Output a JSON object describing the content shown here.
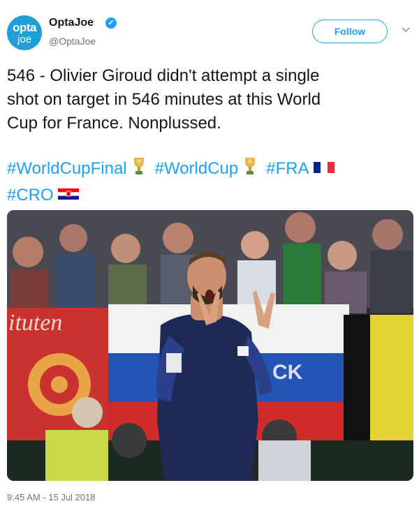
{
  "account": {
    "avatar_line1": "opta",
    "avatar_line2": "joe",
    "display_name": "OptaJoe",
    "handle": "@OptaJoe",
    "verified_icon": "verified-badge-icon"
  },
  "follow_label": "Follow",
  "tweet": {
    "text": "546 - Olivier Giroud didn't attempt a single\nshot on target in 546 minutes at this World\nCup for France. Nonplussed."
  },
  "hashtags": {
    "worldcupfinal": "#WorldCupFinal",
    "worldcup": "#WorldCup",
    "fra": "#FRA",
    "cro": "#CRO"
  },
  "media": {
    "banner_text": "ituten",
    "flag_text": "CK"
  },
  "timestamp": "9:45 AM - 15 Jul 2018",
  "colors": {
    "link": "#1da1f2",
    "avatar": "#1f9fd9",
    "muted": "#657786"
  }
}
